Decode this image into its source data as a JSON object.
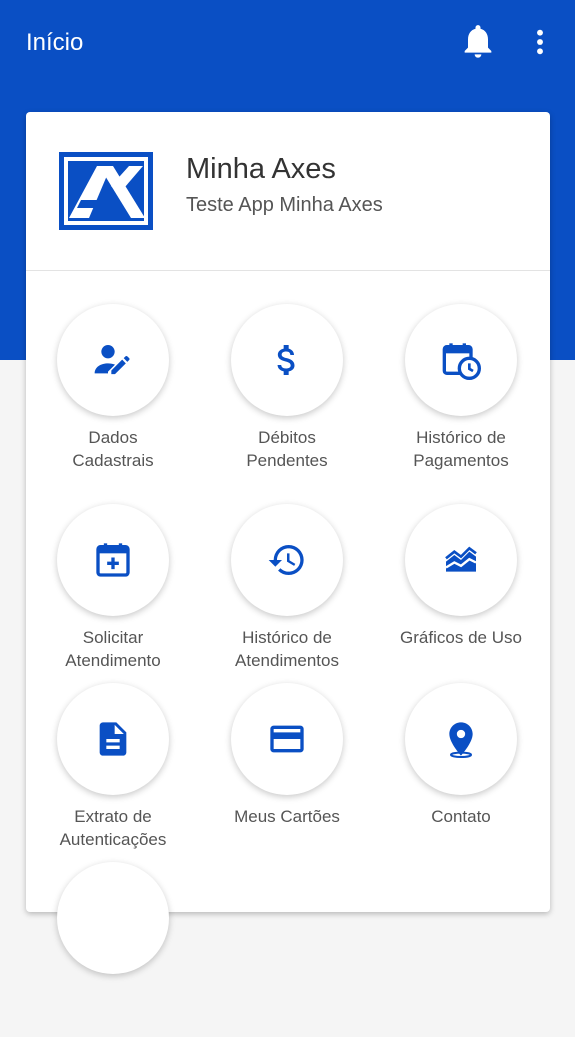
{
  "appbar": {
    "title": "Início",
    "notifications_icon": "bell-icon",
    "menu_icon": "more-vert-icon",
    "color": "#0a4fc4"
  },
  "header": {
    "app_name": "Minha Axes",
    "subtitle": "Teste App Minha Axes",
    "logo": "axes-logo"
  },
  "tiles": [
    {
      "line1": "Dados",
      "line2": "Cadastrais",
      "icon": "edit-user-icon"
    },
    {
      "line1": "Débitos",
      "line2": "Pendentes",
      "icon": "dollar-icon"
    },
    {
      "line1": "Histórico de",
      "line2": "Pagamentos",
      "icon": "calendar-clock-icon"
    },
    {
      "line1": "Solicitar",
      "line2": "Atendimento",
      "icon": "calendar-plus-icon"
    },
    {
      "line1": "Histórico de",
      "line2": "Atendimentos",
      "icon": "history-icon"
    },
    {
      "line1": "Gráficos de Uso",
      "line2": "",
      "icon": "area-chart-icon"
    },
    {
      "line1": "Extrato de",
      "line2": "Autenticações",
      "icon": "document-icon"
    },
    {
      "line1": "Meus Cartões",
      "line2": "",
      "icon": "credit-card-icon"
    },
    {
      "line1": "Contato",
      "line2": "",
      "icon": "location-pin-icon"
    }
  ],
  "accent": "#0a4fc4"
}
